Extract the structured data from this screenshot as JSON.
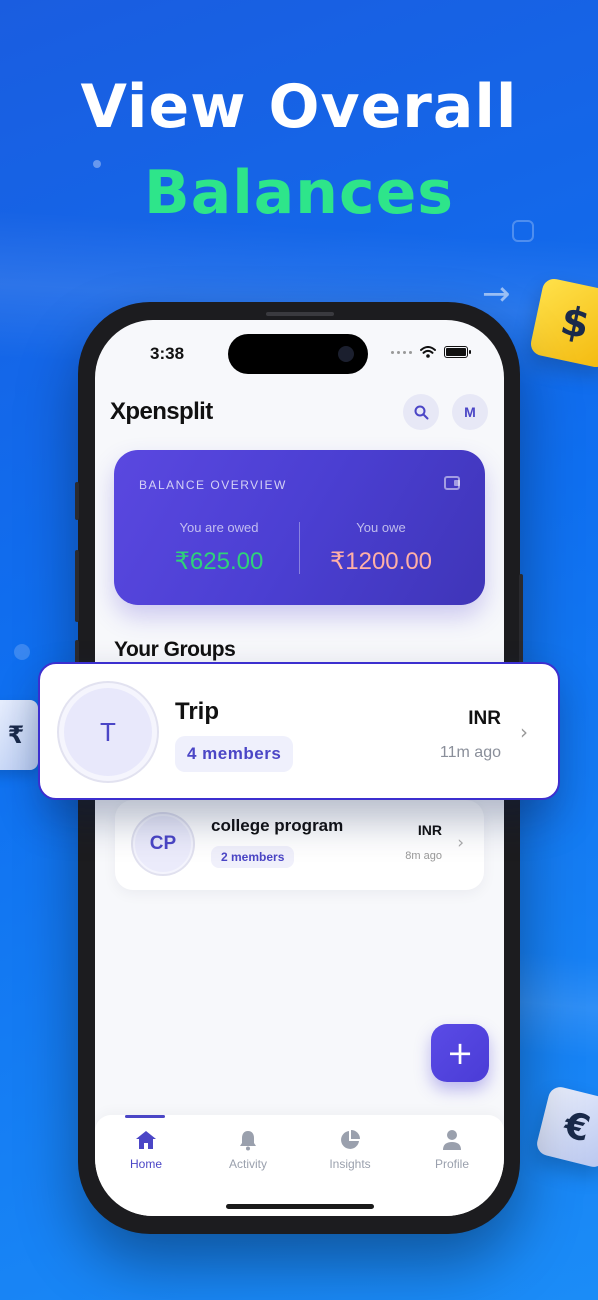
{
  "headline": {
    "line1": "View Overall",
    "line2": "Balances"
  },
  "decor": {
    "dollar": "$",
    "euro": "€",
    "rupee": "₹"
  },
  "status": {
    "time": "3:38"
  },
  "app": {
    "title": "Xpensplit",
    "avatar_initial": "M"
  },
  "balance": {
    "label": "BALANCE OVERVIEW",
    "owed_label": "You are owed",
    "owed_value": "₹625.00",
    "owe_label": "You owe",
    "owe_value": "₹1200.00",
    "owed_color": "#2fd17a",
    "owe_color": "#ffb0a6"
  },
  "groups_title": "Your Groups",
  "featured_group": {
    "initial": "T",
    "name": "Trip",
    "members": "4 members",
    "currency": "INR",
    "updated": "11m ago"
  },
  "groups": [
    {
      "initial": "CP",
      "name": "college program",
      "members": "2 members",
      "currency": "INR",
      "updated": "8m ago"
    }
  ],
  "fab": {
    "icon": "plus-icon",
    "label": "+"
  },
  "tabs": [
    {
      "label": "Home",
      "icon": "home-icon",
      "active": true
    },
    {
      "label": "Activity",
      "icon": "bell-icon",
      "active": false
    },
    {
      "label": "Insights",
      "icon": "pie-chart-icon",
      "active": false
    },
    {
      "label": "Profile",
      "icon": "user-icon",
      "active": false
    }
  ],
  "colors": {
    "accent": "#4b46c6",
    "background_blue": "#1267ee",
    "headline_green": "#2ee58a"
  }
}
